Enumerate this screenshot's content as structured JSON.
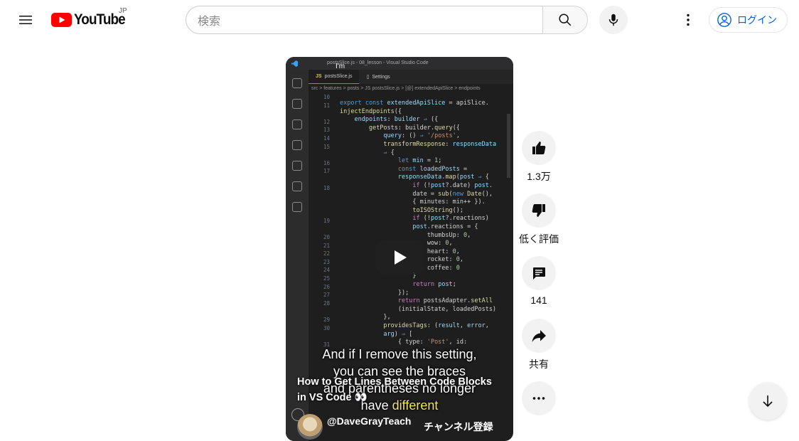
{
  "header": {
    "logo_text": "YouTube",
    "country_code": "JP",
    "search_placeholder": "検索",
    "login_label": "ログイン"
  },
  "short": {
    "editor_title": "postsSlice.js - 08_lesson - Visual Studio Code",
    "top_caption": "I'm",
    "tabs": [
      "postsSlice.js",
      "Settings"
    ],
    "breadcrumb": "src > features > posts > JS postsSlice.js > [@] extendedApiSlice > endpoints",
    "line_numbers": [
      "10",
      "11",
      "",
      "12",
      "13",
      "14",
      "15",
      "",
      "16",
      "17",
      "",
      "18",
      "",
      "",
      "",
      "19",
      "",
      "20",
      "21",
      "22",
      "23",
      "24",
      "25",
      "26",
      "27",
      "28",
      "",
      "29",
      "30",
      "",
      "31"
    ],
    "caption_lines": [
      "And if I remove this setting,",
      "you can see the braces",
      "and parentheses no longer"
    ],
    "caption_last_prefix": "have ",
    "caption_last_highlight": "different",
    "title": "How to Get Lines Between Code Blocks in VS Code 👀",
    "channel": "@DaveGrayTeach",
    "subscribe_label": "チャンネル登録"
  },
  "actions": {
    "like_count": "1.3万",
    "dislike_label": "低く評価",
    "comment_count": "141",
    "share_label": "共有"
  },
  "colors": {
    "brand_red": "#ff0000",
    "link_blue": "#065fd4",
    "caption_highlight": "#f5e16a"
  }
}
